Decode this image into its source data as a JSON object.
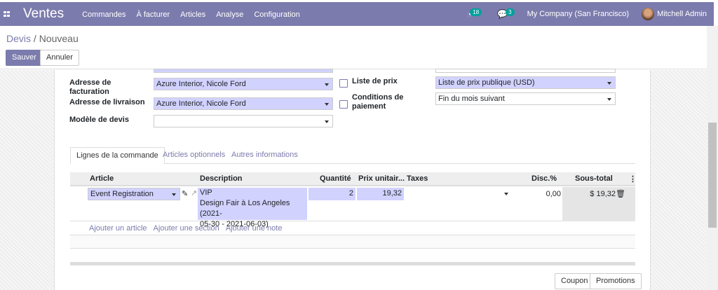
{
  "nav": {
    "app": "Ventes",
    "menu": [
      "Commandes",
      "À facturer",
      "Articles",
      "Analyse",
      "Configuration"
    ],
    "activity_count": "18",
    "message_count": "3",
    "company": "My Company (San Francisco)",
    "user": "Mitchell Admin"
  },
  "breadcrumb": {
    "parent": "Devis",
    "current": "Nouveau"
  },
  "buttons": {
    "save": "Sauver",
    "cancel": "Annuler",
    "coupon": "Coupon",
    "promotions": "Promotions"
  },
  "form": {
    "invoice_address_label": "Adresse de facturation",
    "invoice_address": "Azure Interior, Nicole Ford",
    "delivery_address_label": "Adresse de livraison",
    "delivery_address": "Azure Interior, Nicole Ford",
    "template_label": "Modèle de devis",
    "template": "",
    "pricelist_label": "Liste de prix",
    "pricelist": "Liste de prix publique (USD)",
    "terms_label": "Conditions de paiement",
    "terms": "Fin du mois suivant"
  },
  "tabs": [
    "Lignes de la commande",
    "Articles optionnels",
    "Autres informations"
  ],
  "columns": [
    "Article",
    "Description",
    "Quantité",
    "Prix unitair...",
    "Taxes",
    "Disc.%",
    "Sous-total"
  ],
  "lines": [
    {
      "article": "Event Registration",
      "description_line1": "VIP",
      "description_line2": "Design Fair à Los Angeles (2021-",
      "description_line3": "05-30 - 2021-06-03)",
      "quantity": "2",
      "price": "19,32",
      "taxes": "",
      "discount": "0,00",
      "subtotal": "$ 19,32"
    }
  ],
  "add_links": [
    "Ajouter un article",
    "Ajouter une section",
    "Ajouter une note"
  ],
  "colors": {
    "brand": "#7c7bad",
    "required_field": "#d2d2ff",
    "badge": "#00a09d"
  }
}
